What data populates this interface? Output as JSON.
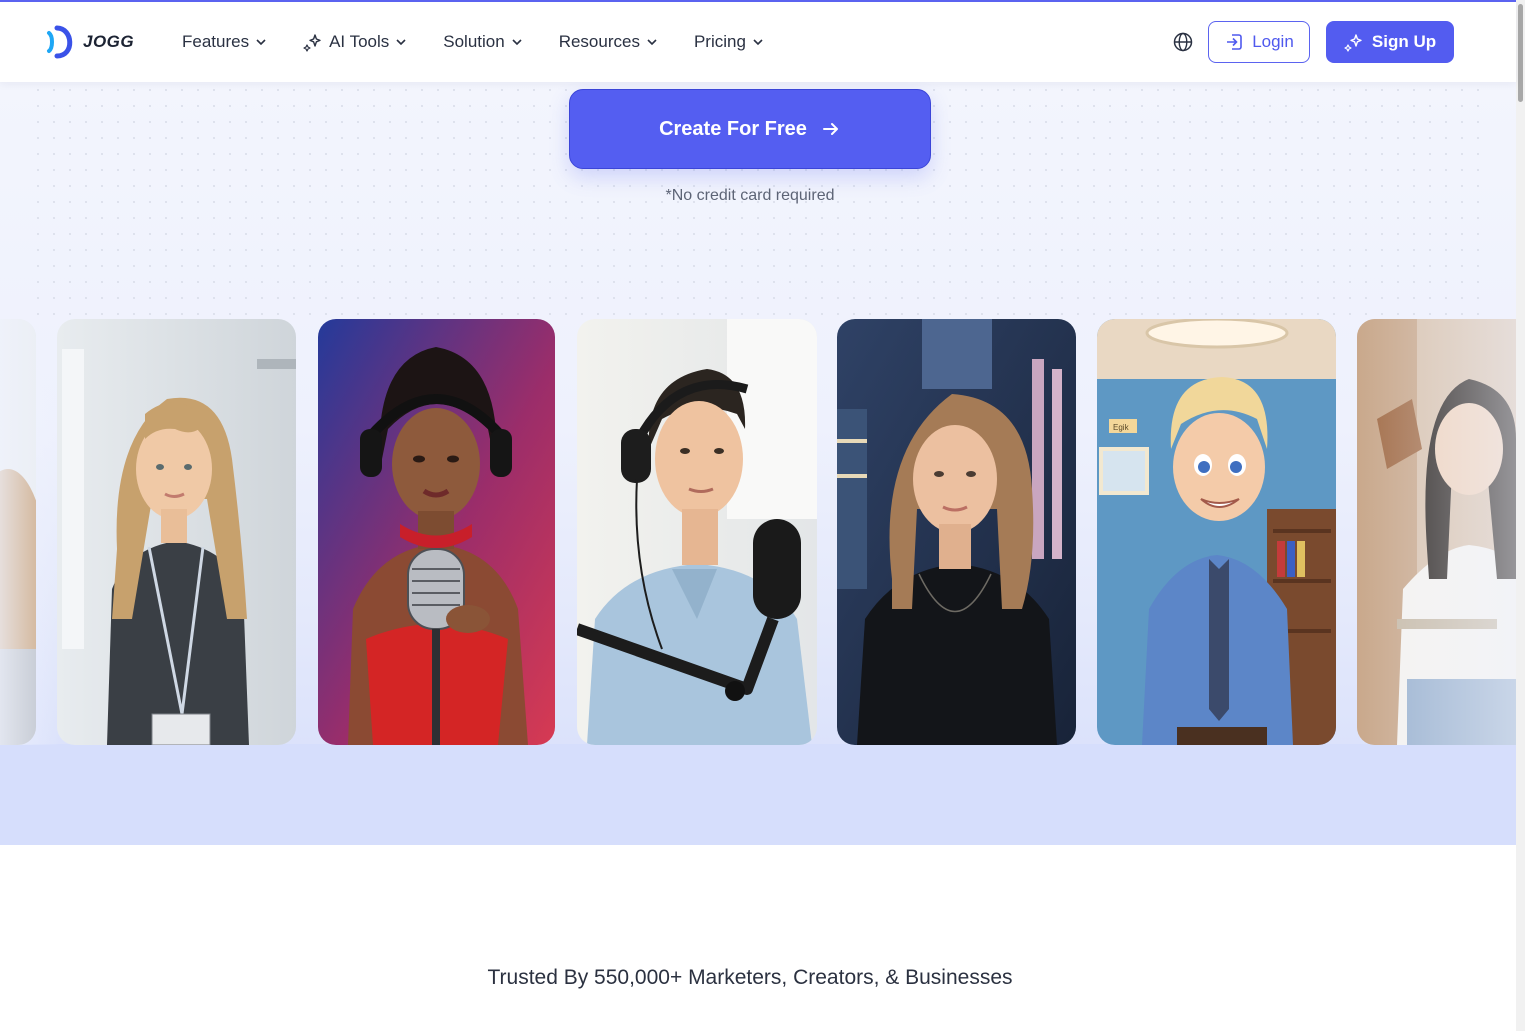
{
  "header": {
    "logo_text": "JOGG",
    "nav": [
      {
        "label": "Features"
      },
      {
        "label": "AI Tools"
      },
      {
        "label": "Solution"
      },
      {
        "label": "Resources"
      },
      {
        "label": "Pricing"
      }
    ],
    "login_label": "Login",
    "signup_label": "Sign Up"
  },
  "hero": {
    "cta_label": "Create For Free",
    "note": "*No credit card required"
  },
  "gallery": {
    "items": [
      {
        "icon": "portrait"
      },
      {
        "icon": "portrait"
      },
      {
        "icon": "portrait"
      },
      {
        "icon": "portrait"
      },
      {
        "icon": "portrait"
      },
      {
        "icon": "portrait"
      },
      {
        "icon": "portrait"
      }
    ],
    "annotations": [
      "Egik"
    ]
  },
  "trusted": {
    "text": "Trusted By 550,000+ Marketers, Creators, & Businesses"
  },
  "colors": {
    "accent": "#535cf0",
    "hero_band": "#d6defc",
    "text": "#2a3142"
  }
}
